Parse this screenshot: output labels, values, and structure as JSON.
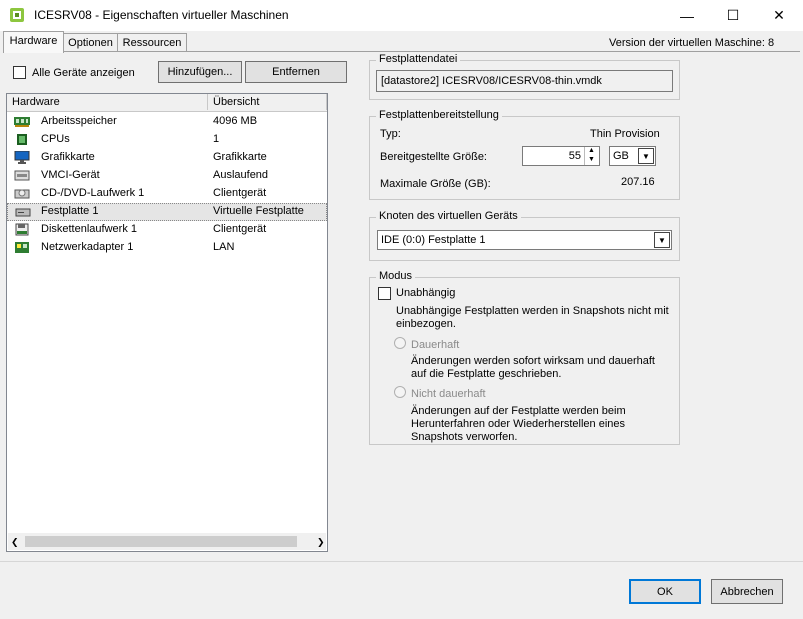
{
  "window": {
    "title": "ICESRV08 - Eigenschaften virtueller Maschinen",
    "minimize": "—",
    "maximize": "☐",
    "close": "✕"
  },
  "tabs": [
    {
      "label": "Hardware",
      "active": true
    },
    {
      "label": "Optionen",
      "active": false
    },
    {
      "label": "Ressourcen",
      "active": false
    }
  ],
  "version_label": "Version der virtuellen Maschine: 8",
  "toolbar": {
    "show_all_label": "Alle Geräte anzeigen",
    "show_all_checked": false,
    "add_label": "Hinzufügen...",
    "remove_label": "Entfernen"
  },
  "hardware_list": {
    "headers": [
      "Hardware",
      "Übersicht"
    ],
    "rows": [
      {
        "name": "Arbeitsspeicher",
        "summary": "4096 MB",
        "icon": "memory-icon",
        "selected": false
      },
      {
        "name": "CPUs",
        "summary": "1",
        "icon": "cpu-icon",
        "selected": false
      },
      {
        "name": "Grafikkarte",
        "summary": "Grafikkarte",
        "icon": "monitor-icon",
        "selected": false
      },
      {
        "name": "VMCI-Gerät",
        "summary": "Auslaufend",
        "icon": "vmci-icon",
        "selected": false
      },
      {
        "name": "CD-/DVD-Laufwerk 1",
        "summary": "Clientgerät",
        "icon": "cd-drive-icon",
        "selected": false
      },
      {
        "name": "Festplatte 1",
        "summary": "Virtuelle Festplatte",
        "icon": "harddisk-icon",
        "selected": true
      },
      {
        "name": "Diskettenlaufwerk 1",
        "summary": "Clientgerät",
        "icon": "floppy-icon",
        "selected": false
      },
      {
        "name": "Netzwerkadapter 1",
        "summary": "LAN",
        "icon": "network-adapter-icon",
        "selected": false
      }
    ]
  },
  "disk_file": {
    "group_title": "Festplattendatei",
    "path": "[datastore2] ICESRV08/ICESRV08-thin.vmdk"
  },
  "provisioning": {
    "group_title": "Festplattenbereitstellung",
    "type_label": "Typ:",
    "type_value": "Thin Provision",
    "size_label": "Bereitgestellte Größe:",
    "size_value": "55",
    "unit_value": "GB",
    "max_label": "Maximale Größe (GB):",
    "max_value": "207.16"
  },
  "device_node": {
    "group_title": "Knoten des virtuellen Geräts",
    "selected": "IDE (0:0) Festplatte 1"
  },
  "mode": {
    "group_title": "Modus",
    "independent_label": "Unabhängig",
    "independent_checked": false,
    "independent_desc_1": "Unabhängige Festplatten werden in Snapshots nicht mit",
    "independent_desc_2": "einbezogen.",
    "persistent_label": "Dauerhaft",
    "persistent_desc_1": "Änderungen werden sofort wirksam und dauerhaft",
    "persistent_desc_2": "auf die Festplatte geschrieben.",
    "nonpersistent_label": "Nicht dauerhaft",
    "nonpersistent_desc_1": "Änderungen auf der Festplatte werden beim",
    "nonpersistent_desc_2": "Herunterfahren oder Wiederherstellen eines",
    "nonpersistent_desc_3": "Snapshots verworfen."
  },
  "footer": {
    "ok_label": "OK",
    "cancel_label": "Abbrechen"
  }
}
